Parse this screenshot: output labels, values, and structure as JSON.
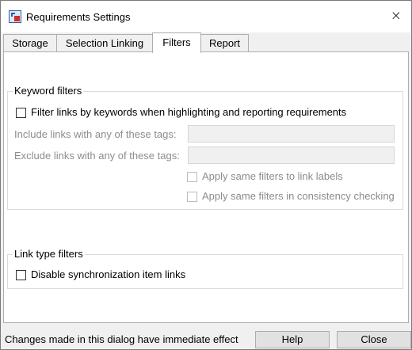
{
  "window": {
    "title": "Requirements Settings",
    "close_glyph": "×"
  },
  "tabs": [
    {
      "label": "Storage",
      "active": false
    },
    {
      "label": "Selection Linking",
      "active": false
    },
    {
      "label": "Filters",
      "active": true
    },
    {
      "label": "Report",
      "active": false
    }
  ],
  "keyword_filters": {
    "group_label": "Keyword filters",
    "filter_checkbox_label": "Filter links by keywords when highlighting and reporting requirements",
    "filter_checked": false,
    "include_label": "Include links with any of these tags:",
    "include_value": "",
    "exclude_label": "Exclude links with any of these tags:",
    "exclude_value": "",
    "apply_labels_checkbox": "Apply same filters to link labels",
    "apply_consistency_checkbox": "Apply same filters in consistency checking"
  },
  "link_type_filters": {
    "group_label": "Link type filters",
    "disable_sync_checkbox": "Disable synchronization item links",
    "disable_sync_checked": false
  },
  "footer": {
    "status_text": "Changes made in this dialog have immediate effect",
    "help_label": "Help",
    "close_label": "Close"
  },
  "icons": {
    "app_icon": "requirements-app-icon",
    "close_icon": "close-icon"
  },
  "colors": {
    "panel_bg": "#ffffff",
    "window_bg": "#f0f0f0",
    "disabled_text": "#8c8c8c",
    "button_bg": "#e1e1e1"
  }
}
